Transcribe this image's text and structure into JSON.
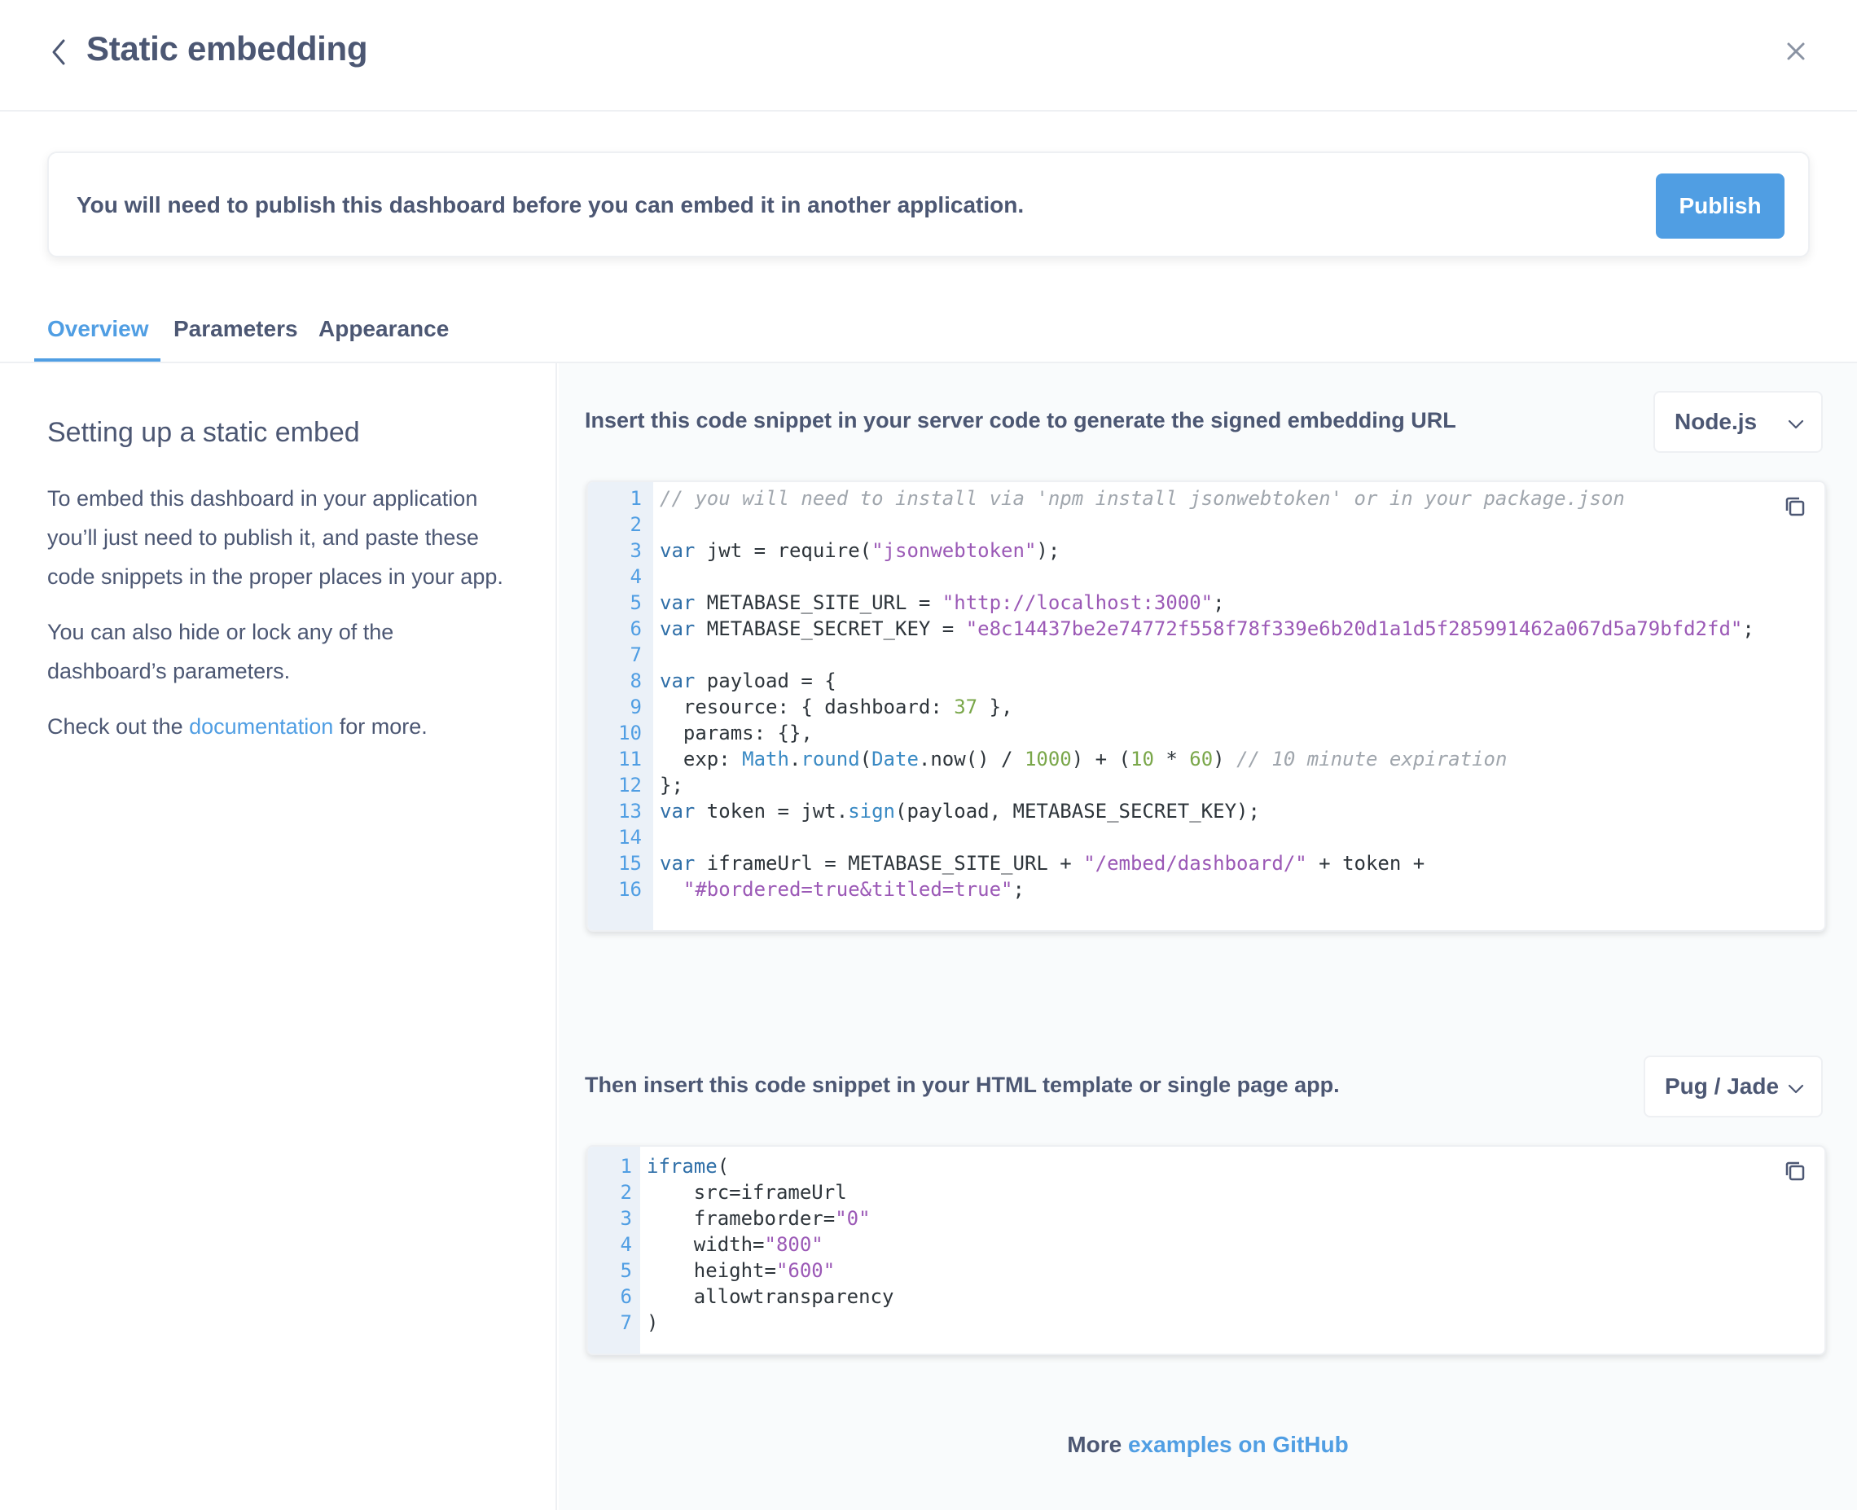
{
  "header": {
    "title": "Static embedding"
  },
  "banner": {
    "message": "You will need to publish this dashboard before you can embed it in another application.",
    "publish_label": "Publish"
  },
  "tabs": [
    {
      "label": "Overview",
      "active": true
    },
    {
      "label": "Parameters",
      "active": false
    },
    {
      "label": "Appearance",
      "active": false
    }
  ],
  "left": {
    "heading": "Setting up a static embed",
    "para1": "To embed this dashboard in your application you’ll just need to publish it, and paste these code snippets in the proper places in your app.",
    "para2": "You can also hide or lock any of the dashboard’s parameters.",
    "para3_prefix": "Check out the ",
    "para3_link": "documentation",
    "para3_suffix": " for more."
  },
  "server_section": {
    "title": "Insert this code snippet in your server code to generate the signed embedding URL",
    "language": "Node.js",
    "lines": [
      [
        [
          "cm",
          "// you will need to install via 'npm install jsonwebtoken' or in your package.json"
        ]
      ],
      [],
      [
        [
          "kw",
          "var"
        ],
        [
          "id",
          " jwt = require("
        ],
        [
          "str",
          "\"jsonwebtoken\""
        ],
        [
          "id",
          ");"
        ]
      ],
      [],
      [
        [
          "kw",
          "var"
        ],
        [
          "id",
          " METABASE_SITE_URL = "
        ],
        [
          "str",
          "\"http://localhost:3000\""
        ],
        [
          "id",
          ";"
        ]
      ],
      [
        [
          "kw",
          "var"
        ],
        [
          "id",
          " METABASE_SECRET_KEY = "
        ],
        [
          "str",
          "\"e8c14437be2e74772f558f78f339e6b20d1a1d5f285991462a067d5a79bfd2fd\""
        ],
        [
          "id",
          ";"
        ]
      ],
      [],
      [
        [
          "kw",
          "var"
        ],
        [
          "id",
          " payload = {"
        ]
      ],
      [
        [
          "id",
          "  resource: { dashboard: "
        ],
        [
          "num",
          "37"
        ],
        [
          "id",
          " },"
        ]
      ],
      [
        [
          "id",
          "  params: {},"
        ]
      ],
      [
        [
          "id",
          "  exp: "
        ],
        [
          "fn",
          "Math"
        ],
        [
          "id",
          "."
        ],
        [
          "fn",
          "round"
        ],
        [
          "id",
          "("
        ],
        [
          "fn",
          "Date"
        ],
        [
          "id",
          ".now() / "
        ],
        [
          "num",
          "1000"
        ],
        [
          "id",
          ") + ("
        ],
        [
          "num",
          "10"
        ],
        [
          "id",
          " * "
        ],
        [
          "num",
          "60"
        ],
        [
          "id",
          ") "
        ],
        [
          "cm",
          "// 10 minute expiration"
        ]
      ],
      [
        [
          "id",
          "};"
        ]
      ],
      [
        [
          "kw",
          "var"
        ],
        [
          "id",
          " token = jwt."
        ],
        [
          "fn",
          "sign"
        ],
        [
          "id",
          "(payload, METABASE_SECRET_KEY);"
        ]
      ],
      [],
      [
        [
          "kw",
          "var"
        ],
        [
          "id",
          " iframeUrl = METABASE_SITE_URL + "
        ],
        [
          "str",
          "\"/embed/dashboard/\""
        ],
        [
          "id",
          " + token +"
        ]
      ],
      [
        [
          "id",
          "  "
        ],
        [
          "str",
          "\"#bordered=true&titled=true\""
        ],
        [
          "id",
          ";"
        ]
      ]
    ]
  },
  "template_section": {
    "title": "Then insert this code snippet in your HTML template or single page app.",
    "language": "Pug / Jade",
    "lines": [
      [
        [
          "kw",
          "iframe"
        ],
        [
          "id",
          "("
        ]
      ],
      [
        [
          "id",
          "    src=iframeUrl"
        ]
      ],
      [
        [
          "id",
          "    frameborder="
        ],
        [
          "str",
          "\"0\""
        ]
      ],
      [
        [
          "id",
          "    width="
        ],
        [
          "str",
          "\"800\""
        ]
      ],
      [
        [
          "id",
          "    height="
        ],
        [
          "str",
          "\"600\""
        ]
      ],
      [
        [
          "id",
          "    allowtransparency"
        ]
      ],
      [
        [
          "id",
          ")"
        ]
      ]
    ]
  },
  "footer": {
    "prefix": "More ",
    "link": "examples on GitHub"
  },
  "icons": {
    "back": "chevron-left-icon",
    "close": "close-icon",
    "copy": "copy-icon",
    "dropdown": "chevron-down-icon"
  },
  "colors": {
    "brand": "#509ee3",
    "text": "#4c5773",
    "border": "#eef0f3",
    "gutter": "#ebf1f8",
    "keyword": "#2f6fa8",
    "string": "#9b59b6",
    "number": "#7aa74a",
    "comment": "#a0a6ad"
  }
}
